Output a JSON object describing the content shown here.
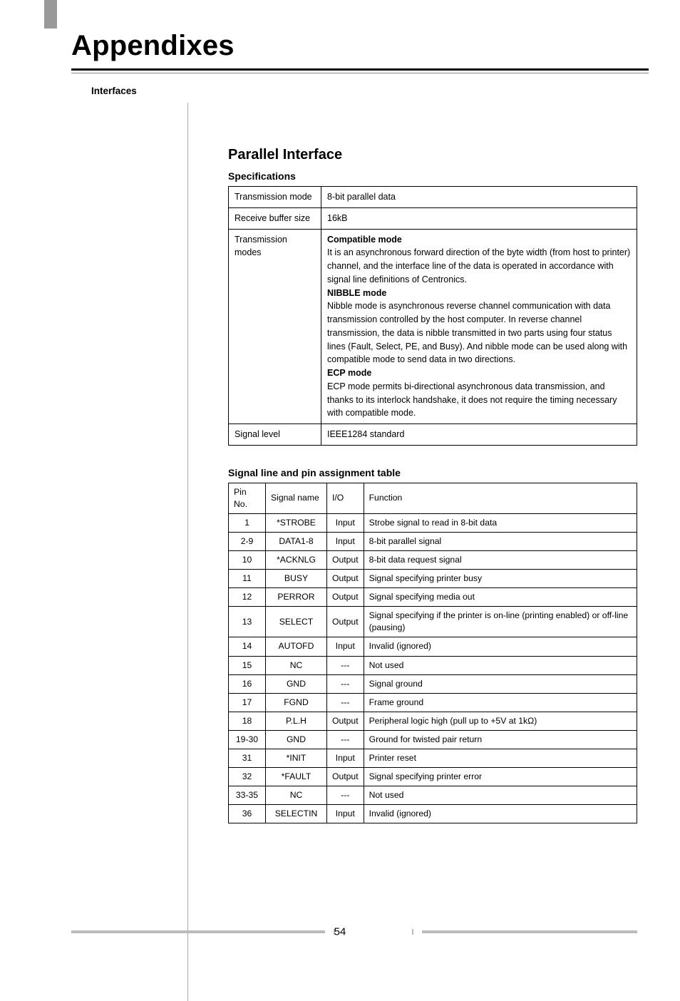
{
  "title": "Appendixes",
  "section_label": "Interfaces",
  "parallel": {
    "heading": "Parallel Interface",
    "specs_heading": "Specifications",
    "specs": [
      {
        "k": "Transmission mode",
        "v": "8-bit parallel data"
      },
      {
        "k": "Receive buffer size",
        "v": "16kB"
      }
    ],
    "modes_k": "Transmission modes",
    "modes": {
      "compat_title": "Compatible mode",
      "compat_body": "It is an asynchronous forward direction of the byte width (from host to printer) channel, and the interface line of the data is operated in accordance with signal line definitions of Centronics.",
      "nibble_title": "NIBBLE mode",
      "nibble_body": "Nibble mode is asynchronous reverse channel communication with data transmission controlled by the host computer. In reverse channel transmission, the data is nibble transmitted in two parts using four status lines (Fault, Select, PE, and Busy). And nibble mode can be used along with compatible mode to send data in two directions.",
      "ecp_title": "ECP mode",
      "ecp_body": "ECP mode permits bi-directional asynchronous data transmission, and thanks to its interlock handshake, it does not require the timing necessary with compatible mode."
    },
    "signal_level_k": "Signal level",
    "signal_level_v": "IEEE1284 standard",
    "pin_heading": "Signal line and pin assignment table",
    "pin_headers": {
      "pin": "Pin No.",
      "name": "Signal name",
      "io": "I/O",
      "func": "Function"
    },
    "pins": [
      {
        "pin": "1",
        "name": "*STROBE",
        "io": "Input",
        "func": "Strobe signal to read in 8-bit data"
      },
      {
        "pin": "2-9",
        "name": "DATA1-8",
        "io": "Input",
        "func": "8-bit parallel signal"
      },
      {
        "pin": "10",
        "name": "*ACKNLG",
        "io": "Output",
        "func": "8-bit data request signal"
      },
      {
        "pin": "11",
        "name": "BUSY",
        "io": "Output",
        "func": "Signal specifying printer busy"
      },
      {
        "pin": "12",
        "name": "PERROR",
        "io": "Output",
        "func": "Signal specifying media out"
      },
      {
        "pin": "13",
        "name": "SELECT",
        "io": "Output",
        "func": "Signal specifying if the printer is on-line (printing enabled) or off-line (pausing)"
      },
      {
        "pin": "14",
        "name": "AUTOFD",
        "io": "Input",
        "func": "Invalid (ignored)"
      },
      {
        "pin": "15",
        "name": "NC",
        "io": "---",
        "func": "Not used"
      },
      {
        "pin": "16",
        "name": "GND",
        "io": "---",
        "func": "Signal ground"
      },
      {
        "pin": "17",
        "name": "FGND",
        "io": "---",
        "func": "Frame ground"
      },
      {
        "pin": "18",
        "name": "P.L.H",
        "io": "Output",
        "func": "Peripheral logic high (pull up to +5V at 1kΩ)"
      },
      {
        "pin": "19-30",
        "name": "GND",
        "io": "---",
        "func": "Ground for twisted pair return"
      },
      {
        "pin": "31",
        "name": "*INIT",
        "io": "Input",
        "func": "Printer reset"
      },
      {
        "pin": "32",
        "name": "*FAULT",
        "io": "Output",
        "func": "Signal specifying printer error"
      },
      {
        "pin": "33-35",
        "name": "NC",
        "io": "---",
        "func": "Not used"
      },
      {
        "pin": "36",
        "name": "SELECTIN",
        "io": "Input",
        "func": "Invalid (ignored)"
      }
    ]
  },
  "page_number": "54"
}
